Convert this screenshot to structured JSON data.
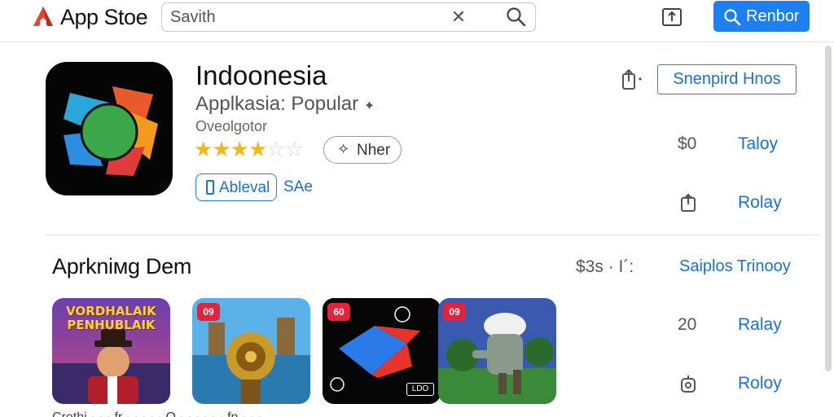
{
  "topbar": {
    "brand": "App Stoe",
    "search_placeholder": "Savith",
    "button_label": "Renbor"
  },
  "hero": {
    "app_name": "Indoonesia",
    "category": "Applkasia: Popular",
    "developer": "Oveolgotor",
    "rating": 3.5,
    "rating_max": 5,
    "pill_label": "Nher",
    "get_label": "Ableval",
    "secondary_link": "SAe",
    "outline_button": "Snenpird Hnos",
    "rows": [
      {
        "price": "$0",
        "link": "Taloy"
      },
      {
        "price": "",
        "link": "Rolay"
      }
    ]
  },
  "section": {
    "title": "Aprkniмg Dem",
    "price": "$3s · Ι´:",
    "link": "Saiplos Trinooy",
    "rows": [
      {
        "price": "20",
        "link": "Ralay"
      },
      {
        "price": "",
        "link": "Roloy"
      }
    ],
    "thumbnails": [
      {
        "label": "VORDHALAIK PENHUBLAIK",
        "badge": ""
      },
      {
        "label": "",
        "badge": "09"
      },
      {
        "label": "",
        "badge": "60",
        "corner": "LDO"
      },
      {
        "label": "",
        "badge": "09"
      }
    ],
    "footer_text": "Crothi  ·  ·  ·  fr  ·  ·  ·  ·  ·  O  ·  ·  ·  ·  ·  ·  fn  ·  ·  ·"
  },
  "colors": {
    "accent": "#1d7ff0",
    "star": "#f2b71c",
    "badge": "#e6223a"
  }
}
